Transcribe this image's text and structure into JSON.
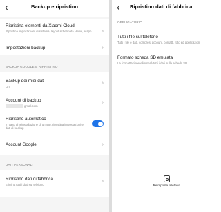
{
  "left": {
    "title": "Backup e ripristino",
    "back_glyph": "‹",
    "items_top": [
      {
        "label": "Ripristina elementi da Xiaomi Cloud",
        "sub": "Ripristina impostazioni di sistema, layout schermata Home, e app"
      },
      {
        "label": "Impostazioni backup",
        "sub": ""
      }
    ],
    "section_google": "BACKUP GOOGLE E RIPRISTINO",
    "backup_data": {
      "label": "Backup dei miei dati",
      "sub": "On"
    },
    "backup_account": {
      "label": "Account di backup",
      "sub": "gmail.com"
    },
    "auto_restore": {
      "label": "Ripristino automatico",
      "sub": "In caso di reinstallazione di un'app, ripristina impostazioni e dati di backup",
      "toggle": "on",
      "toggle_color": "#1f74e8"
    },
    "google_account": {
      "label": "Account Google"
    },
    "section_personal": "DATI PERSONALI",
    "factory": {
      "label": "Ripristino dati di fabbrica",
      "sub": "Elimina tutti i dati sul telefono"
    },
    "chevron_glyph": "›"
  },
  "right": {
    "title": "Ripristino dati di fabbrica",
    "back_glyph": "‹",
    "section": "OBBLIGATORIO",
    "all_files": {
      "label": "Tutti i file sul telefono",
      "sub": "Tutti i file e dati, compresi account, contatti, foto ed applicazioni"
    },
    "format_sd": {
      "label": "Formato scheda SD emulata",
      "sub": "La formattazione eliminerà tutti i dati sulla scheda SD"
    },
    "reset_button": {
      "label": "Reimposta telefono",
      "icon": "phone-reset-icon"
    }
  }
}
